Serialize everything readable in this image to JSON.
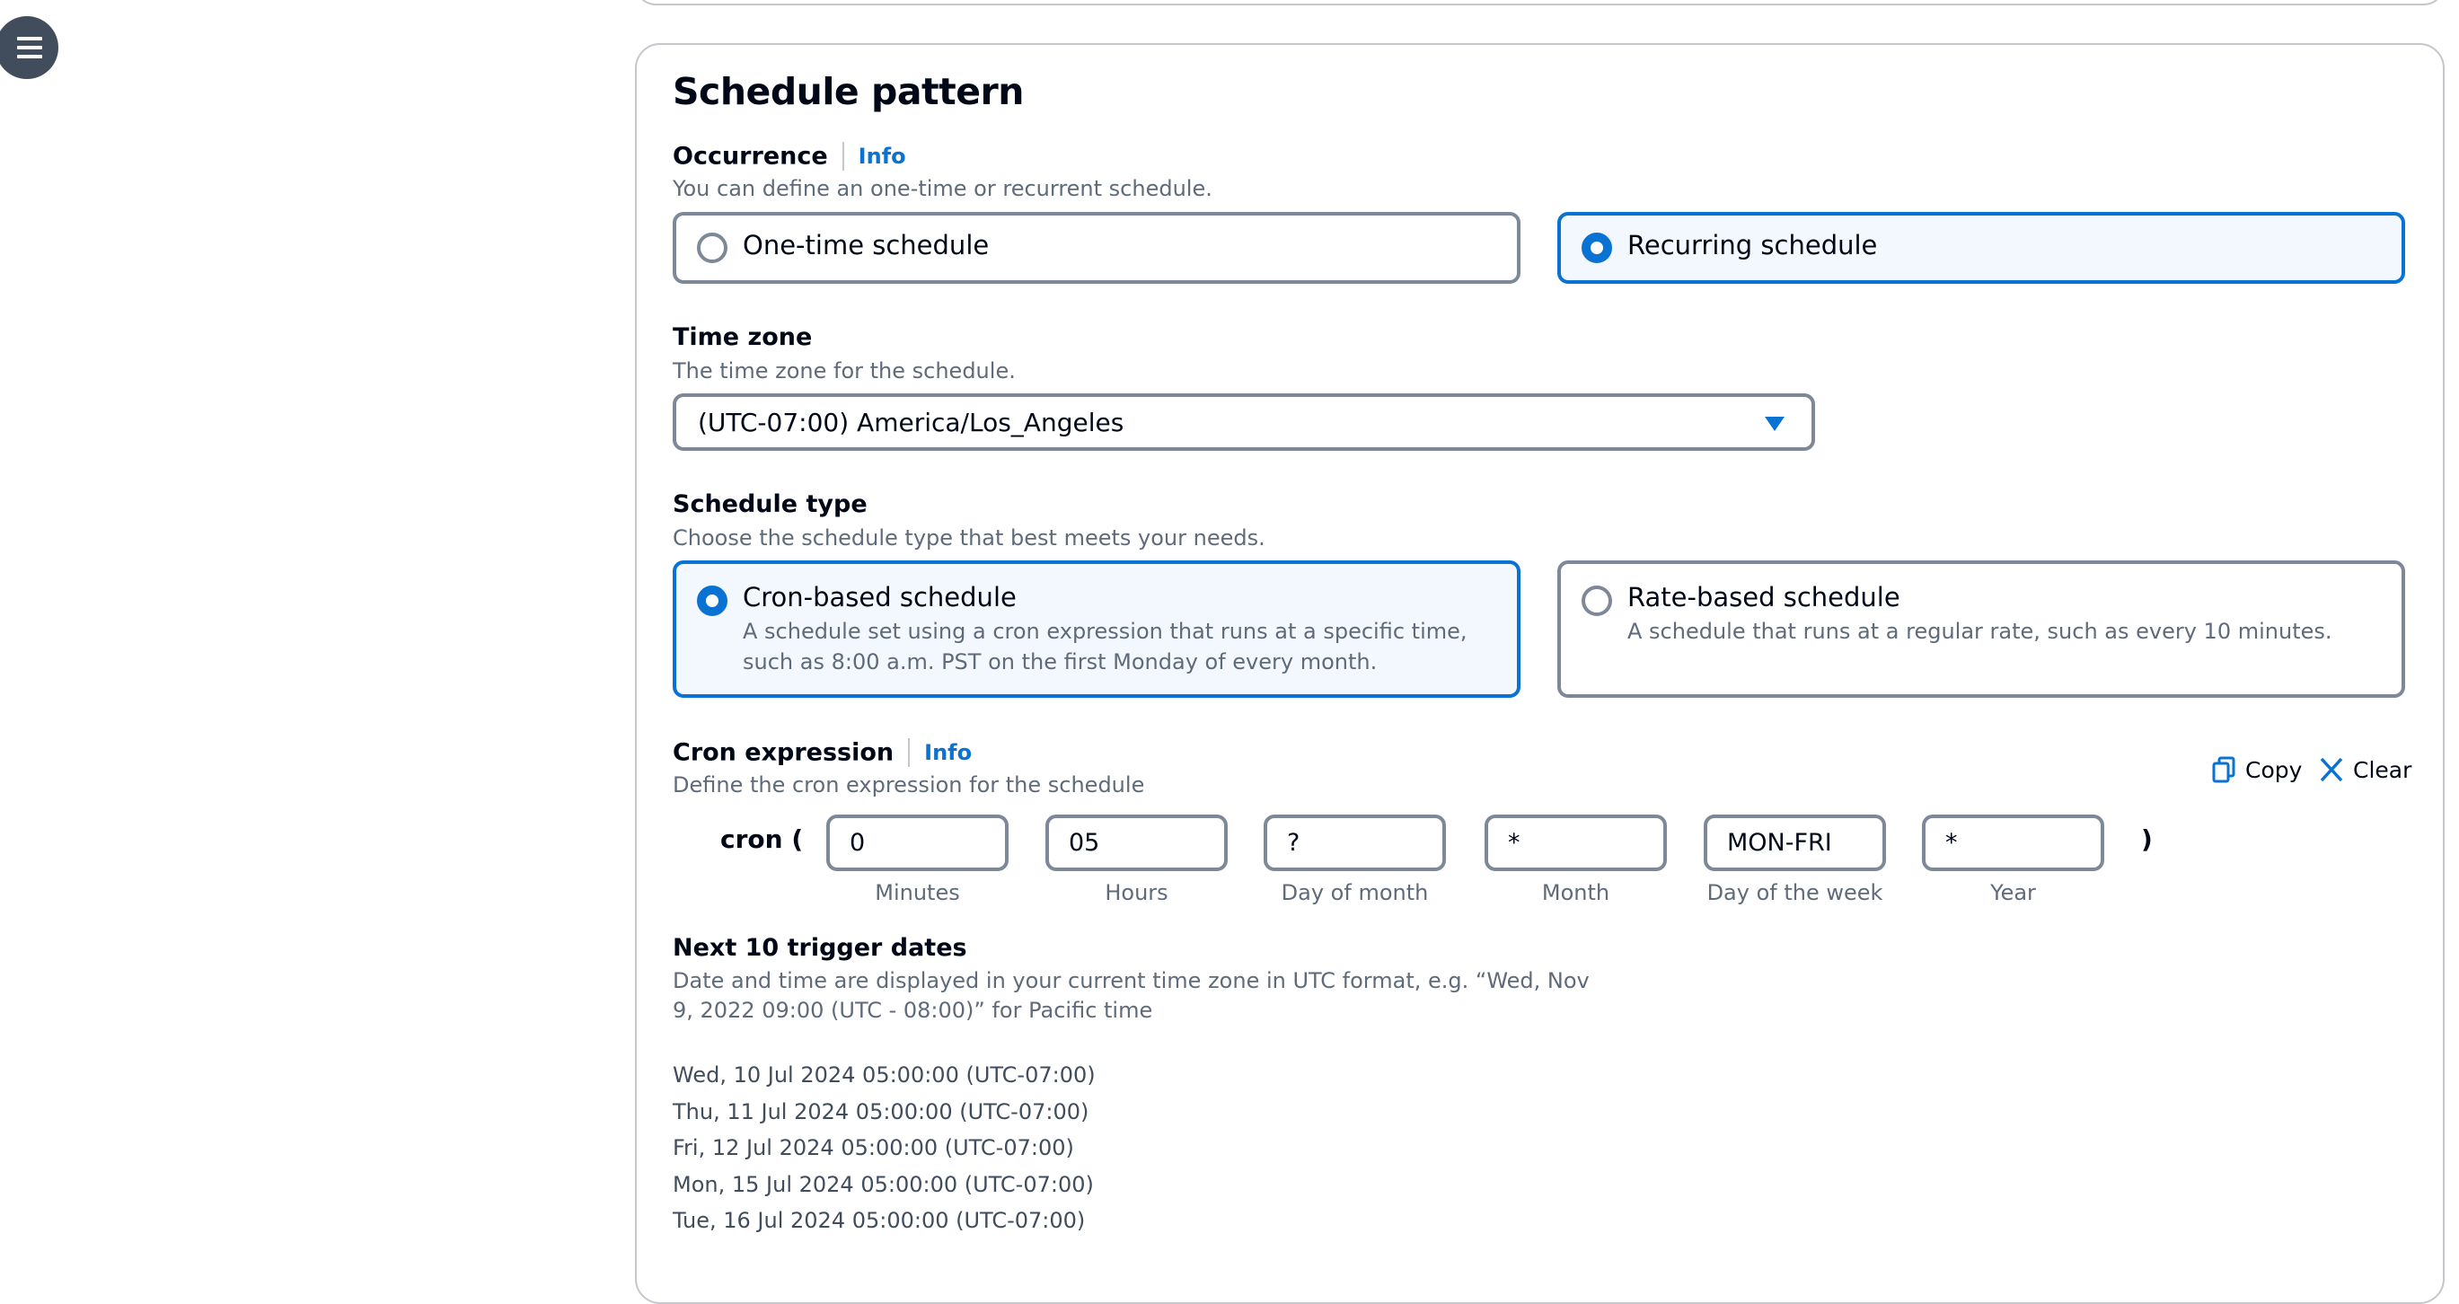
{
  "nav": {
    "menu_icon": "hamburger-menu-icon"
  },
  "section": {
    "title": "Schedule pattern"
  },
  "occurrence": {
    "label": "Occurrence",
    "info": "Info",
    "description": "You can define an one-time or recurrent schedule.",
    "options": [
      {
        "label": "One-time schedule",
        "selected": false
      },
      {
        "label": "Recurring schedule",
        "selected": true
      }
    ]
  },
  "timezone": {
    "label": "Time zone",
    "description": "The time zone for the schedule.",
    "value": "(UTC-07:00) America/Los_Angeles"
  },
  "schedule_type": {
    "label": "Schedule type",
    "description": "Choose the schedule type that best meets your needs.",
    "options": [
      {
        "label": "Cron-based schedule",
        "description": "A schedule set using a cron expression that runs at a specific time, such as 8:00 a.m. PST on the first Monday of every month.",
        "selected": true
      },
      {
        "label": "Rate-based schedule",
        "description": "A schedule that runs at a regular rate, such as every 10 minutes.",
        "selected": false
      }
    ]
  },
  "cron": {
    "label": "Cron expression",
    "info": "Info",
    "description": "Define the cron expression for the schedule",
    "prefix": "cron (",
    "suffix": ")",
    "copy_label": "Copy",
    "clear_label": "Clear",
    "fields": [
      {
        "value": "0",
        "caption": "Minutes"
      },
      {
        "value": "05",
        "caption": "Hours"
      },
      {
        "value": "?",
        "caption": "Day of month"
      },
      {
        "value": "*",
        "caption": "Month"
      },
      {
        "value": "MON-FRI",
        "caption": "Day of the week"
      },
      {
        "value": "*",
        "caption": "Year"
      }
    ]
  },
  "triggers": {
    "label": "Next 10 trigger dates",
    "description_line1": "Date and time are displayed in your current time zone in UTC format, e.g. “Wed, Nov",
    "description_line2": "9, 2022 09:00 (UTC - 08:00)” for Pacific time",
    "dates": [
      "Wed, 10 Jul 2024 05:00:00 (UTC-07:00)",
      "Thu, 11 Jul 2024 05:00:00 (UTC-07:00)",
      "Fri, 12 Jul 2024 05:00:00 (UTC-07:00)",
      "Mon, 15 Jul 2024 05:00:00 (UTC-07:00)",
      "Tue, 16 Jul 2024 05:00:00 (UTC-07:00)"
    ]
  },
  "colors": {
    "accent": "#0972d3",
    "border": "#7d8998",
    "selected_bg": "#f2f8fd",
    "muted_text": "#5f6b7a"
  }
}
